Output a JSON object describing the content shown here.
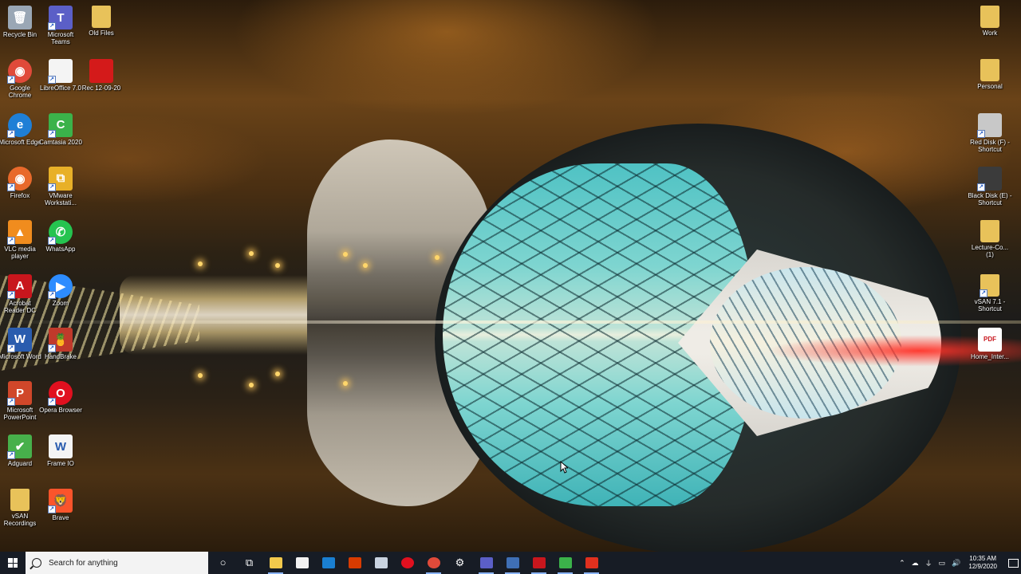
{
  "desktop_icons_left": [
    {
      "label": "Recycle Bin",
      "icon": "recycle-bin-icon",
      "color": "#9aa7b5",
      "glyph": "🗑",
      "col": 0,
      "row": 0
    },
    {
      "label": "Microsoft Teams",
      "icon": "teams-icon",
      "color": "#5b5fc7",
      "glyph": "T",
      "col": 1,
      "row": 0
    },
    {
      "label": "Old Files",
      "icon": "folder-icon",
      "color": "#e8c25a",
      "glyph": "",
      "col": 2,
      "row": 0
    },
    {
      "label": "Google Chrome",
      "icon": "chrome-icon",
      "color": "#e04a3a",
      "glyph": "◉",
      "col": 0,
      "row": 1
    },
    {
      "label": "LibreOffice 7.0",
      "icon": "libreoffice-icon",
      "color": "#f4f4f4",
      "glyph": "",
      "col": 1,
      "row": 1
    },
    {
      "label": "Rec 12-09-20",
      "icon": "video-file-icon",
      "color": "#d41a1a",
      "glyph": "",
      "col": 2,
      "row": 1
    },
    {
      "label": "Microsoft Edge",
      "icon": "edge-icon",
      "color": "#1f7fd6",
      "glyph": "e",
      "col": 0,
      "row": 2
    },
    {
      "label": "Camtasia 2020",
      "icon": "camtasia-icon",
      "color": "#3bb24a",
      "glyph": "C",
      "col": 1,
      "row": 2
    },
    {
      "label": "Firefox",
      "icon": "firefox-icon",
      "color": "#e8692b",
      "glyph": "◉",
      "col": 0,
      "row": 3
    },
    {
      "label": "VMware Workstati...",
      "icon": "vmware-icon",
      "color": "#e8b028",
      "glyph": "⧉",
      "col": 1,
      "row": 3
    },
    {
      "label": "VLC media player",
      "icon": "vlc-icon",
      "color": "#f08c1e",
      "glyph": "▲",
      "col": 0,
      "row": 4
    },
    {
      "label": "WhatsApp",
      "icon": "whatsapp-icon",
      "color": "#25c450",
      "glyph": "✆",
      "col": 1,
      "row": 4
    },
    {
      "label": "Acrobat Reader DC",
      "icon": "acrobat-icon",
      "color": "#c8161d",
      "glyph": "A",
      "col": 0,
      "row": 5
    },
    {
      "label": "Zoom",
      "icon": "zoom-icon",
      "color": "#2d8cff",
      "glyph": "▶",
      "col": 1,
      "row": 5
    },
    {
      "label": "Microsoft Word",
      "icon": "word-icon",
      "color": "#2a5cae",
      "glyph": "W",
      "col": 0,
      "row": 6
    },
    {
      "label": "HandBrake",
      "icon": "handbrake-icon",
      "color": "#c0392b",
      "glyph": "🍍",
      "col": 1,
      "row": 6
    },
    {
      "label": "Microsoft PowerPoint",
      "icon": "powerpoint-icon",
      "color": "#d0472a",
      "glyph": "P",
      "col": 0,
      "row": 7
    },
    {
      "label": "Opera Browser",
      "icon": "opera-icon",
      "color": "#e0101f",
      "glyph": "O",
      "col": 1,
      "row": 7
    },
    {
      "label": "Adguard",
      "icon": "adguard-icon",
      "color": "#47b04b",
      "glyph": "✔",
      "col": 0,
      "row": 8
    },
    {
      "label": "Frame IO",
      "icon": "document-icon",
      "color": "#f4f4f4",
      "glyph": "W",
      "col": 1,
      "row": 8
    },
    {
      "label": "vSAN Recordings",
      "icon": "folder-icon",
      "color": "#e8c25a",
      "glyph": "",
      "col": 0,
      "row": 9
    },
    {
      "label": "Brave",
      "icon": "brave-icon",
      "color": "#fb542b",
      "glyph": "🦁",
      "col": 1,
      "row": 9
    }
  ],
  "desktop_icons_right": [
    {
      "label": "Work",
      "icon": "folder-icon",
      "color": "#e8c25a",
      "glyph": "",
      "row": 0
    },
    {
      "label": "Personal",
      "icon": "folder-icon",
      "color": "#e8c25a",
      "glyph": "",
      "row": 1
    },
    {
      "label": "Red Disk (F) - Shortcut",
      "icon": "drive-icon",
      "color": "#c8c8c8",
      "glyph": "",
      "row": 2
    },
    {
      "label": "Black Disk (E) - Shortcut",
      "icon": "drive-icon",
      "color": "#3b3b3b",
      "glyph": "",
      "row": 3
    },
    {
      "label": "Lecture-Co... (1)",
      "icon": "folder-icon",
      "color": "#e8c25a",
      "glyph": "",
      "row": 4
    },
    {
      "label": "vSAN 7.1 - Shortcut",
      "icon": "folder-icon",
      "color": "#e8c25a",
      "glyph": "",
      "row": 5
    },
    {
      "label": "Home_Inter...",
      "icon": "pdf-icon",
      "color": "#ffffff",
      "glyph": "PDF",
      "row": 6
    }
  ],
  "taskbar": {
    "search_placeholder": "Search for anything",
    "pinned": [
      {
        "name": "cortana-icon",
        "color": "transparent",
        "open": false,
        "glyph": "○"
      },
      {
        "name": "task-view-icon",
        "color": "transparent",
        "open": false,
        "glyph": "⧉"
      },
      {
        "name": "file-explorer-icon",
        "color": "#f2c94c",
        "open": true,
        "glyph": ""
      },
      {
        "name": "store-icon",
        "color": "#f2f2f2",
        "open": false,
        "glyph": ""
      },
      {
        "name": "mail-icon",
        "color": "#1a7fd1",
        "open": false,
        "glyph": ""
      },
      {
        "name": "office-icon",
        "color": "#d83b01",
        "open": false,
        "glyph": ""
      },
      {
        "name": "snip-icon",
        "color": "#c9d3e0",
        "open": false,
        "glyph": ""
      },
      {
        "name": "opera-icon",
        "color": "#e0101f",
        "open": false,
        "glyph": ""
      },
      {
        "name": "chrome-icon",
        "color": "#e04a3a",
        "open": true,
        "glyph": ""
      },
      {
        "name": "settings-icon",
        "color": "transparent",
        "open": false,
        "glyph": "⚙"
      },
      {
        "name": "teams-icon",
        "color": "#5b5fc7",
        "open": true,
        "glyph": ""
      },
      {
        "name": "remote-desktop-icon",
        "color": "#3f6fb5",
        "open": true,
        "glyph": ""
      },
      {
        "name": "acrobat-icon",
        "color": "#c8161d",
        "open": true,
        "glyph": ""
      },
      {
        "name": "camtasia-icon",
        "color": "#3bb24a",
        "open": true,
        "glyph": ""
      },
      {
        "name": "camtasia-recorder-icon",
        "color": "#e0301e",
        "open": true,
        "glyph": ""
      }
    ],
    "tray_icons": [
      "chevron-up-icon",
      "cloud-icon",
      "usb-icon",
      "network-icon",
      "volume-icon"
    ],
    "clock_time": "10:35 AM",
    "clock_date": "12/9/2020"
  }
}
